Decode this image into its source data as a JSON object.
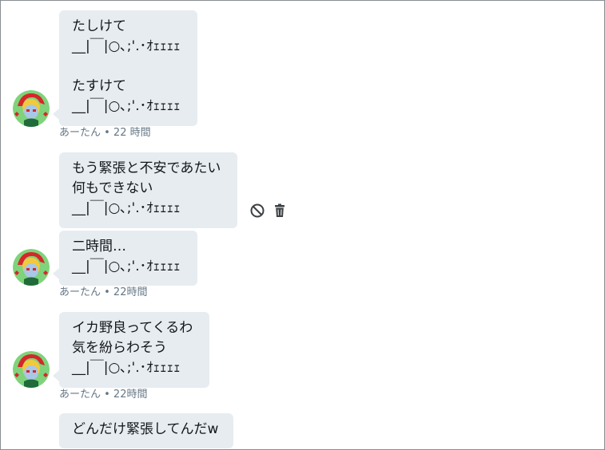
{
  "messages": [
    {
      "text": "たしけて\n__|￣|○､;'.･ｵｪｪｪｪ\n\nたすけて\n__|￣|○､;'.･ｵｪｪｪｪ",
      "meta": "あーたん • 22 時間"
    },
    {
      "text": "もう緊張と不安であたい\n何もできない\n__|￣|○､;'.･ｵｪｪｪｪ"
    },
    {
      "text": "二時間…\n__|￣|○､;'.･ｵｪｪｪｪ",
      "meta": "あーたん • 22時間"
    },
    {
      "text": "イカ野良ってくるわ\n気を紛らわそう\n__|￣|○､;'.･ｵｪｪｪｪ",
      "meta": "あーたん • 22時間"
    },
    {
      "text": "どんだけ緊張してんだw"
    }
  ],
  "icons": {
    "report": "block-icon",
    "delete": "trash-icon"
  },
  "colors": {
    "bubble": "#e6ecf0",
    "meta": "#657786",
    "icon": "#3c4043"
  }
}
